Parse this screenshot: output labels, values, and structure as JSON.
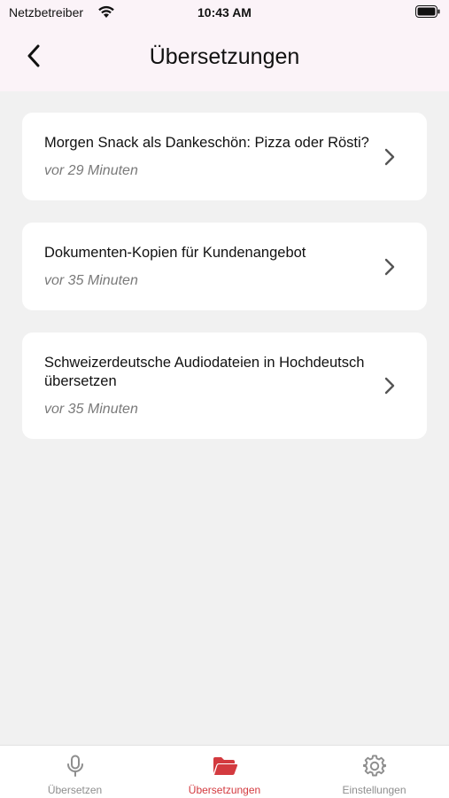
{
  "status_bar": {
    "carrier": "Netzbetreiber",
    "time": "10:43 AM"
  },
  "header": {
    "title": "Übersetzungen",
    "back_icon": "chevron-left-icon"
  },
  "items": [
    {
      "title": "Morgen Snack als Dankeschön: Pizza oder Rösti?",
      "time": "vor 29 Minuten"
    },
    {
      "title": "Dokumenten-Kopien für Kundenangebot",
      "time": "vor 35 Minuten"
    },
    {
      "title": "Schweizerdeutsche Audiodateien in Hochdeutsch übersetzen",
      "time": "vor 35 Minuten"
    }
  ],
  "tabs": [
    {
      "label": "Übersetzen",
      "icon": "microphone-icon",
      "active": false
    },
    {
      "label": "Übersetzungen",
      "icon": "folder-icon",
      "active": true
    },
    {
      "label": "Einstellungen",
      "icon": "gear-icon",
      "active": false
    }
  ],
  "colors": {
    "accent": "#d33a3f",
    "header_bg": "#fbf3f8",
    "page_bg": "#f1f1f1",
    "inactive": "#8e8e8e"
  }
}
